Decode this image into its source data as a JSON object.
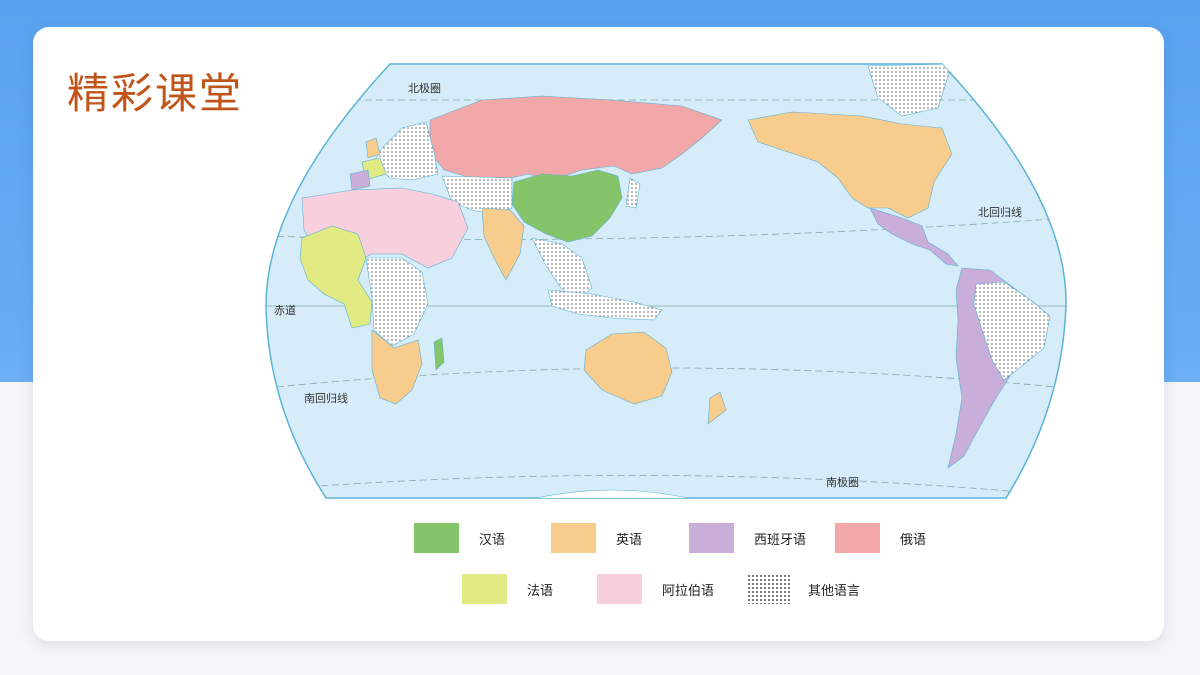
{
  "slide": {
    "title": "精彩课堂"
  },
  "map": {
    "labels": {
      "arctic_circle": "北极圈",
      "tropic_of_cancer": "北回归线",
      "equator": "赤道",
      "tropic_of_capricorn": "南回归线",
      "antarctic_circle": "南极圈"
    },
    "colors": {
      "ocean": "#d6ecf8",
      "border": "#5bb3d6",
      "chinese": "#86c46a",
      "english": "#f7cc8d",
      "spanish": "#c8aed8",
      "russian": "#f2a7a8",
      "french": "#e2ea84",
      "arabic": "#f8cfdd",
      "other": "#ffffff"
    }
  },
  "legend": {
    "items": [
      {
        "key": "chinese",
        "label": "汉语",
        "color": "#86c46a"
      },
      {
        "key": "english",
        "label": "英语",
        "color": "#f7cc8d"
      },
      {
        "key": "spanish",
        "label": "西班牙语",
        "color": "#c8aed8"
      },
      {
        "key": "russian",
        "label": "俄语",
        "color": "#f2a7a8"
      },
      {
        "key": "french",
        "label": "法语",
        "color": "#e2ea84"
      },
      {
        "key": "arabic",
        "label": "阿拉伯语",
        "color": "#f8cfdd"
      },
      {
        "key": "other",
        "label": "其他语言",
        "color": "#ffffff",
        "pattern": "dots"
      }
    ]
  }
}
